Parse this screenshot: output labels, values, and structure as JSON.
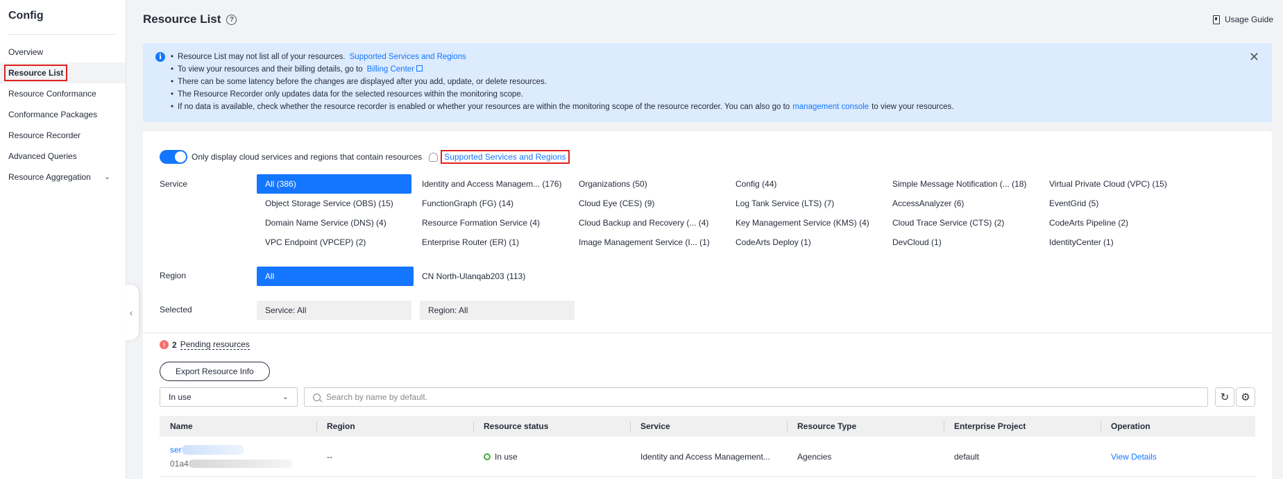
{
  "sidebar": {
    "title": "Config",
    "items": [
      {
        "label": "Overview"
      },
      {
        "label": "Resource List"
      },
      {
        "label": "Resource Conformance"
      },
      {
        "label": "Conformance Packages"
      },
      {
        "label": "Resource Recorder"
      },
      {
        "label": "Advanced Queries"
      },
      {
        "label": "Resource Aggregation"
      }
    ]
  },
  "header": {
    "title": "Resource List",
    "help_glyph": "?",
    "usage_guide": "Usage Guide"
  },
  "notice": {
    "line1": "Resource List may not list all of your resources.",
    "line1_link": "Supported Services and Regions",
    "line2": "To view your resources and their billing details, go to",
    "line2_link": "Billing Center",
    "line3": "There can be some latency before the changes are displayed after you add, update, or delete resources.",
    "line4": "The Resource Recorder only updates data for the selected resources within the monitoring scope.",
    "line5_a": "If no data is available, check whether the resource recorder is enabled or whether your resources are within the monitoring scope of the resource recorder. You can also go to",
    "line5_link": "management console",
    "line5_b": "to view your resources."
  },
  "filters": {
    "toggle_label": "Only display cloud services and regions that contain resources",
    "ssr_link": "Supported Services and Regions",
    "service_label": "Service",
    "services": [
      "All (386)",
      "Identity and Access Managem...  (176)",
      "Organizations (50)",
      "Config (44)",
      "Simple Message Notification (...  (18)",
      "Virtual Private Cloud (VPC) (15)",
      "Object Storage Service (OBS) (15)",
      "FunctionGraph (FG) (14)",
      "Cloud Eye (CES) (9)",
      "Log Tank Service (LTS) (7)",
      "AccessAnalyzer (6)",
      "EventGrid (5)",
      "Domain Name Service (DNS) (4)",
      "Resource Formation Service (4)",
      "Cloud Backup and Recovery (...  (4)",
      "Key Management Service (KMS) (4)",
      "Cloud Trace Service (CTS) (2)",
      "CodeArts Pipeline (2)",
      "VPC Endpoint (VPCEP) (2)",
      "Enterprise Router (ER) (1)",
      "Image Management Service (I...  (1)",
      "CodeArts Deploy (1)",
      "DevCloud (1)",
      "IdentityCenter (1)"
    ],
    "region_label": "Region",
    "regions": [
      "All",
      "CN North-Ulanqab203 (113)"
    ],
    "selected_label": "Selected",
    "selected_service": "Service: All",
    "selected_region": "Region: All"
  },
  "pending": {
    "count": "2",
    "label": "Pending resources",
    "icon_glyph": "!"
  },
  "toolbar": {
    "export_label": "Export Resource Info",
    "status_select": "In use",
    "search_placeholder": "Search by name by default."
  },
  "table": {
    "columns": [
      "Name",
      "Region",
      "Resource status",
      "Service",
      "Resource Type",
      "Enterprise Project",
      "Operation"
    ],
    "rows": [
      {
        "name_prefix": "ser",
        "id_prefix": "01a4",
        "region": "--",
        "status": "In use",
        "service": "Identity and Access Management...",
        "type": "Agencies",
        "project": "default",
        "operation": "View Details"
      }
    ]
  }
}
